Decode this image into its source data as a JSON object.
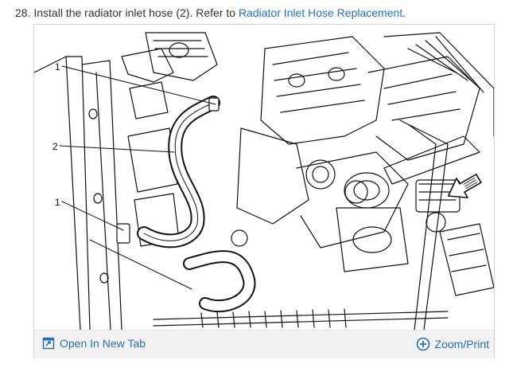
{
  "instruction": {
    "number": "28.",
    "text": " Install the radiator inlet hose (2). Refer to ",
    "link_text": "Radiator Inlet Hose Replacement",
    "end": "."
  },
  "figure": {
    "callouts": [
      "1",
      "2",
      "1"
    ]
  },
  "footer": {
    "open_tab_label": "Open In New Tab",
    "zoom_label": "Zoom/Print"
  },
  "colors": {
    "link": "#2a6ebb",
    "footer_bg": "#f3f3f3"
  },
  "icons": {
    "open_tab": "open-new-tab-icon",
    "zoom": "zoom-plus-icon",
    "direction": "front-arrow-icon"
  }
}
